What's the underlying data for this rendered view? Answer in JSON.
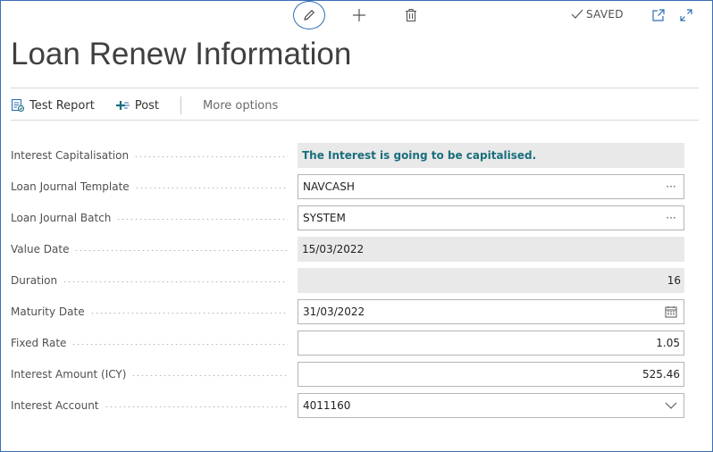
{
  "toolbar": {
    "edit_icon": "pencil-icon",
    "new_icon": "plus-icon",
    "delete_icon": "trash-icon",
    "saved_label": "SAVED",
    "popout_icon": "popout-icon",
    "expand_icon": "expand-icon"
  },
  "page": {
    "title": "Loan Renew Information"
  },
  "actions": {
    "test_report": "Test Report",
    "post": "Post",
    "more_options": "More options"
  },
  "fields": [
    {
      "label": "Interest Capitalisation",
      "value": "The Interest is going to be capitalised.",
      "kind": "readonly"
    },
    {
      "label": "Loan Journal Template",
      "value": "NAVCASH",
      "kind": "lookup"
    },
    {
      "label": "Loan Journal Batch",
      "value": "SYSTEM",
      "kind": "lookup"
    },
    {
      "label": "Value Date",
      "value": "15/03/2022",
      "kind": "readonly"
    },
    {
      "label": "Duration",
      "value": "16",
      "kind": "readonly"
    },
    {
      "label": "Maturity Date",
      "value": "31/03/2022",
      "kind": "date"
    },
    {
      "label": "Fixed Rate",
      "value": "1.05",
      "kind": "number"
    },
    {
      "label": "Interest Amount (ICY)",
      "value": "525.46",
      "kind": "number"
    },
    {
      "label": "Interest Account",
      "value": "4011160",
      "kind": "dropdown"
    }
  ],
  "colors": {
    "accent": "#2c6db5",
    "highlight_text": "#1a6e7c",
    "readonly_bg": "#e9e9e9"
  }
}
